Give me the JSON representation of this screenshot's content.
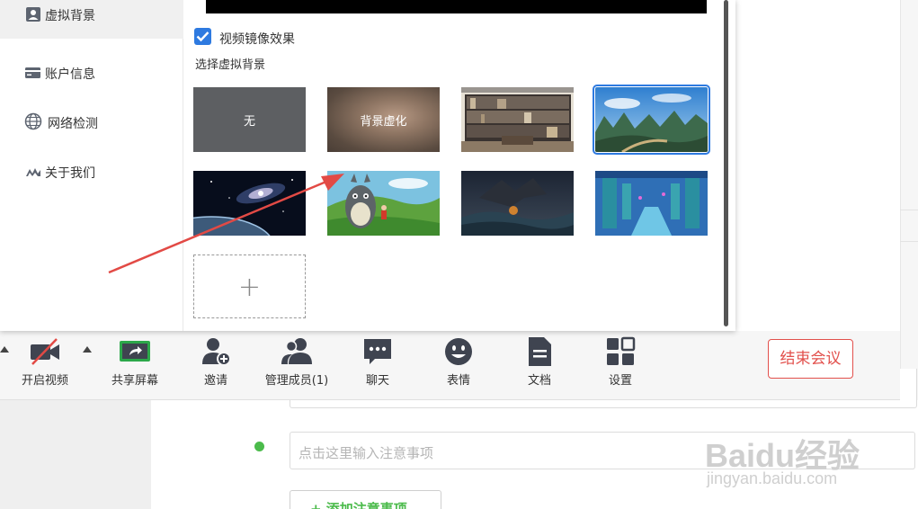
{
  "sidebar": {
    "items": [
      {
        "label": "虚拟背景",
        "icon": "user-card-icon",
        "active": true
      },
      {
        "label": "账户信息",
        "icon": "card-icon"
      },
      {
        "label": "网络检测",
        "icon": "globe-icon"
      },
      {
        "label": "关于我们",
        "icon": "logo-icon"
      }
    ]
  },
  "virtual_bg": {
    "mirror_label": "视频镜像效果",
    "mirror_checked": true,
    "choose_label": "选择虚拟背景",
    "thumbs": [
      {
        "label": "无",
        "kind": "none"
      },
      {
        "label": "背景虚化",
        "kind": "blur"
      },
      {
        "label": "",
        "kind": "bookshelf"
      },
      {
        "label": "",
        "kind": "karst-landscape",
        "selected": true
      },
      {
        "label": "",
        "kind": "galaxy"
      },
      {
        "label": "",
        "kind": "totoro"
      },
      {
        "label": "",
        "kind": "dragon-sea"
      },
      {
        "label": "",
        "kind": "underwater-ruins"
      }
    ],
    "add_symbol": "+"
  },
  "toolbar": {
    "items": [
      {
        "label": "开启视频",
        "icon": "video-off-icon"
      },
      {
        "label": "共享屏幕",
        "icon": "share-screen-icon"
      },
      {
        "label": "邀请",
        "icon": "invite-icon"
      },
      {
        "label": "管理成员(1)",
        "icon": "members-icon"
      },
      {
        "label": "聊天",
        "icon": "chat-icon"
      },
      {
        "label": "表情",
        "icon": "emoji-icon"
      },
      {
        "label": "文档",
        "icon": "document-icon"
      },
      {
        "label": "设置",
        "icon": "settings-icon"
      }
    ],
    "end_label": "结束会议"
  },
  "background_page": {
    "note_placeholder": "点击这里输入注意事项",
    "add_note_label": "+ 添加注意事项"
  },
  "watermark": {
    "brand": "Baidu经验",
    "url": "jingyan.baidu.com"
  },
  "colors": {
    "accent_blue": "#2e7ae0",
    "end_red": "#e2504c",
    "green": "#4bbb4b",
    "arrow_red": "#e24a45"
  }
}
